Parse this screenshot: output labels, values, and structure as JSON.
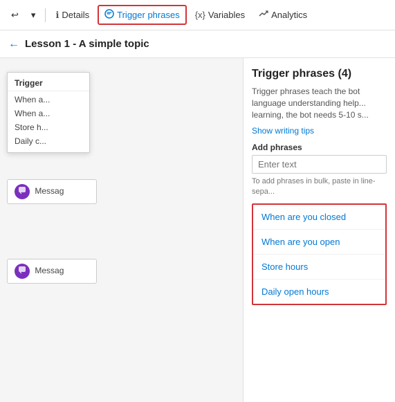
{
  "toolbar": {
    "undo_label": "↩",
    "undo_more_label": "▾",
    "details_label": "Details",
    "trigger_phrases_label": "Trigger phrases",
    "variables_label": "Variables",
    "analytics_label": "Analytics",
    "details_icon": "ℹ",
    "trigger_icon": "💬",
    "variables_icon": "{x}",
    "analytics_icon": "📈"
  },
  "breadcrumb": {
    "back_icon": "←",
    "title": "Lesson 1 - A simple topic"
  },
  "dropdown": {
    "header": "Trigger",
    "items": [
      "When a...",
      "When a...",
      "Store h...",
      "Daily c..."
    ]
  },
  "canvas": {
    "node1_label": "Messag",
    "node2_label": "Messag",
    "icon_char": "💬"
  },
  "panel": {
    "title": "Trigger phrases (4)",
    "description": "Trigger phrases teach the bot language understanding help... learning, the bot needs 5-10 s...",
    "show_tips_label": "Show writing tips",
    "add_phrases_label": "Add phrases",
    "input_placeholder": "Enter text",
    "hint_text": "To add phrases in bulk, paste in line-sepa...",
    "phrases": [
      "When are you closed",
      "When are you open",
      "Store hours",
      "Daily open hours"
    ]
  }
}
